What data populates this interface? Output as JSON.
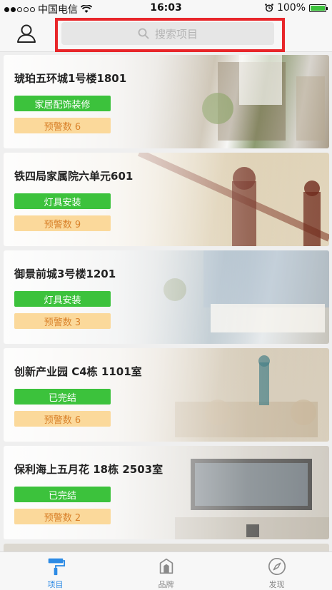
{
  "status_bar": {
    "carrier": "中国电信",
    "time": "16:03",
    "battery": "100%",
    "battery_level": 1.0
  },
  "header": {
    "search_placeholder": "搜索项目",
    "profile_icon": "user-icon",
    "search_icon": "search-icon"
  },
  "projects": [
    {
      "title": "琥珀五环城1号楼1801",
      "status": "家居配饰装修",
      "warning": "预警数 6"
    },
    {
      "title": "铁四局家属院六单元601",
      "status": "灯具安装",
      "warning": "预警数 9"
    },
    {
      "title": "御景前城3号楼1201",
      "status": "灯具安装",
      "warning": "预警数 3"
    },
    {
      "title": "创新产业园 C4栋 1101室",
      "status": "已完结",
      "warning": "预警数 6"
    },
    {
      "title": "保利海上五月花 18栋 2503室",
      "status": "已完结",
      "warning": "预警数 2"
    }
  ],
  "tabs": [
    {
      "label": "项目",
      "icon": "paint-roller-icon",
      "active": true
    },
    {
      "label": "品牌",
      "icon": "brand-box-icon",
      "active": false
    },
    {
      "label": "发现",
      "icon": "compass-icon",
      "active": false
    }
  ],
  "colors": {
    "accent": "#2d8be5",
    "status_tag": "#3cc23c",
    "warning_tag_bg": "#fbd99b",
    "warning_tag_text": "#d9822b",
    "highlight": "#e8262a"
  }
}
